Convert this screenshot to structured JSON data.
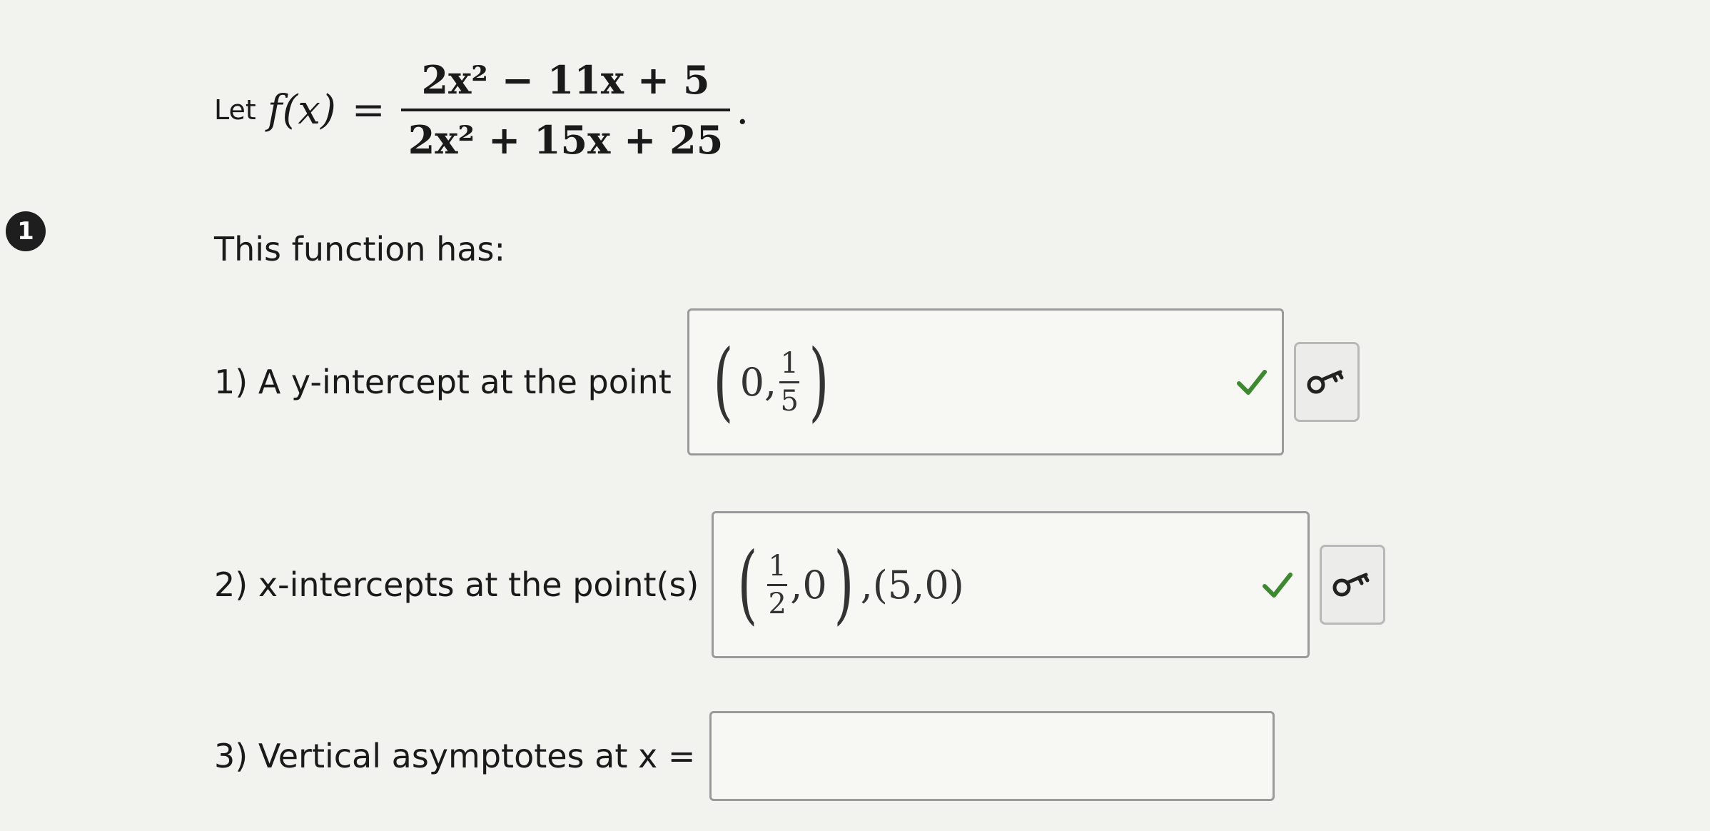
{
  "question_number": "1",
  "function": {
    "let": "Let",
    "name": "f(x)",
    "equals": "=",
    "numerator": "2x² − 11x + 5",
    "denominator": "2x² + 15x + 25",
    "period": "."
  },
  "prompt": "This function has:",
  "items": [
    {
      "label": "1) A y-intercept at the point",
      "answer": {
        "open": "(",
        "a": "0",
        "sep": ",",
        "frac_num": "1",
        "frac_den": "5",
        "close": ")"
      },
      "status": "correct"
    },
    {
      "label": "2) x-intercepts at the point(s)",
      "answer": {
        "open": "(",
        "frac_num": "1",
        "frac_den": "2",
        "sep": ",",
        "b": "0",
        "close": ")",
        "rest": ",(5,0)"
      },
      "status": "correct"
    },
    {
      "label": "3) Vertical asymptotes at x =",
      "value": ""
    }
  ],
  "icons": {
    "check": "check-icon",
    "key": "key-icon"
  },
  "colors": {
    "check": "#3c8a2e",
    "badge": "#1e1e1e"
  }
}
